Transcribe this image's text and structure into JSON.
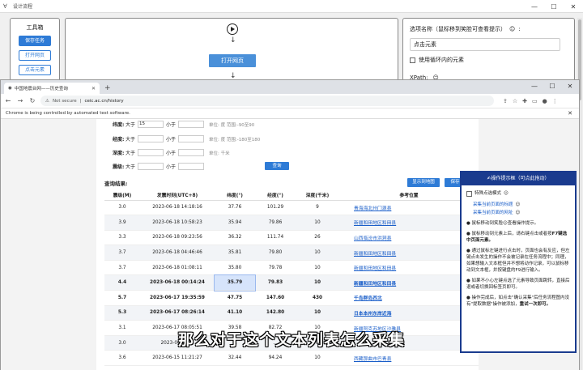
{
  "app": {
    "title": "设计流程"
  },
  "toolbox": {
    "title": "工具箱",
    "buttons": [
      "保存任务",
      "打开网页",
      "点击元素"
    ]
  },
  "canvas": {
    "node_label": "打开网页"
  },
  "options": {
    "name_label": "选项名称（鼠标移到笑脸可查看提示）",
    "name_value": "点击元素",
    "loop_label": "使用循环内的元素",
    "xpath_label": "XPath:"
  },
  "browser": {
    "tab_title": "中国地震台网——历史查询",
    "url_security": "Not secure",
    "url": "ceic.ac.cn/history",
    "automation_notice": "Chrome is being controlled by automated test software."
  },
  "filters": [
    {
      "label": "纬度:",
      "gt": "大于",
      "gt_value": "15",
      "lt": "小于",
      "lt_value": "",
      "unit": "单位: 度 范围:-90至90"
    },
    {
      "label": "经度:",
      "gt": "大于",
      "gt_value": "",
      "lt": "小于",
      "lt_value": "",
      "unit": "单位: 度 范围:-180至180"
    },
    {
      "label": "深度:",
      "gt": "大于",
      "gt_value": "",
      "lt": "小于",
      "lt_value": "",
      "unit": "单位: 千米"
    },
    {
      "label": "震级:",
      "gt": "大于",
      "gt_value": "",
      "lt": "小于",
      "lt_value": "",
      "unit": ""
    }
  ],
  "query_button": "查询",
  "results": {
    "title": "查询结果:",
    "map_button": "显示到地图",
    "print_button": "保存",
    "headers": [
      "震级(M)",
      "发震时刻(UTC+8)",
      "纬度(°)",
      "经度(°)",
      "深度(千米)",
      "参考位置"
    ],
    "rows": [
      {
        "mag": "3.0",
        "time": "2023-06-18 14:18:16",
        "lat": "37.76",
        "lon": "101.29",
        "depth": "9",
        "loc": "青海海北州门源县",
        "bold": false
      },
      {
        "mag": "3.9",
        "time": "2023-06-18 10:58:23",
        "lat": "35.94",
        "lon": "79.86",
        "depth": "10",
        "loc": "新疆和田地区和田县",
        "bold": false
      },
      {
        "mag": "3.3",
        "time": "2023-06-18 09:23:56",
        "lat": "36.32",
        "lon": "111.74",
        "depth": "26",
        "loc": "山西临汾市洪洞县",
        "bold": false
      },
      {
        "mag": "3.7",
        "mag2": "",
        "time": "2023-06-18 04:46:46",
        "lat": "35.81",
        "lon": "79.80",
        "depth": "10",
        "loc": "新疆和田地区和田县",
        "bold": false
      },
      {
        "mag": "3.7",
        "time": "2023-06-18 01:08:11",
        "lat": "35.80",
        "lon": "79.78",
        "depth": "10",
        "loc": "新疆和田地区和田县",
        "bold": false
      },
      {
        "mag": "4.4",
        "time": "2023-06-18 00:14:24",
        "lat": "35.79",
        "lon": "79.83",
        "depth": "10",
        "loc": "新疆和田地区和田县",
        "bold": true
      },
      {
        "mag": "5.7",
        "time": "2023-06-17 19:35:59",
        "lat": "47.75",
        "lon": "147.60",
        "depth": "430",
        "loc": "千岛群岛西北",
        "bold": true
      },
      {
        "mag": "5.3",
        "time": "2023-06-17 08:26:14",
        "lat": "41.10",
        "lon": "142.80",
        "depth": "10",
        "loc": "日本本州东岸近海",
        "bold": true
      },
      {
        "mag": "3.1",
        "time": "2023-06-17 08:05:51",
        "lat": "39.58",
        "lon": "82.72",
        "depth": "10",
        "loc": "新疆阿克苏地区沙雅县",
        "bold": false
      },
      {
        "mag": "3.0",
        "time": "2023-06-16 ...",
        "lat": "...",
        "lon": "...",
        "depth": "",
        "loc": "",
        "bold": false
      },
      {
        "mag": "3.6",
        "time": "2023-06-15 11:21:27",
        "lat": "32.44",
        "lon": "94.24",
        "depth": "10",
        "loc": "西藏那曲市巴青县",
        "bold": false
      }
    ]
  },
  "prompt": {
    "title": "✍操作提示框（可点此拖动）",
    "special_label": "特殊点选模式",
    "link1": "采集当前页面的标题",
    "link2": "采集当前页面的网址",
    "p1": "● 鼠标移动到笑脸☺查看操作提示。",
    "p2a": "● 鼠标移动到元素上后，请右键点击或者按",
    "p2b": "F7键选中页面元素。",
    "p3": "● 通过鼠标左键进行点击时，页面也会有反应，但左键点击发生的操作不会被记录在任务流程中；同理，如果想输入文本框但并不想将动作记录，可以鼠标移动到文本框，并按键盘的F9进行输入。",
    "p4": "● 如果不小心左键点选了元素导致页面跳转，直接后退或者切换回标签页即可。",
    "p5a": "● 操作完成后，如点击\"确认采集\"后任务流程图内没有\"提取数据\"操作被添加，",
    "p5b": "重试一次即可。"
  },
  "subtitle": "那么对于这个文本列表怎么采集"
}
